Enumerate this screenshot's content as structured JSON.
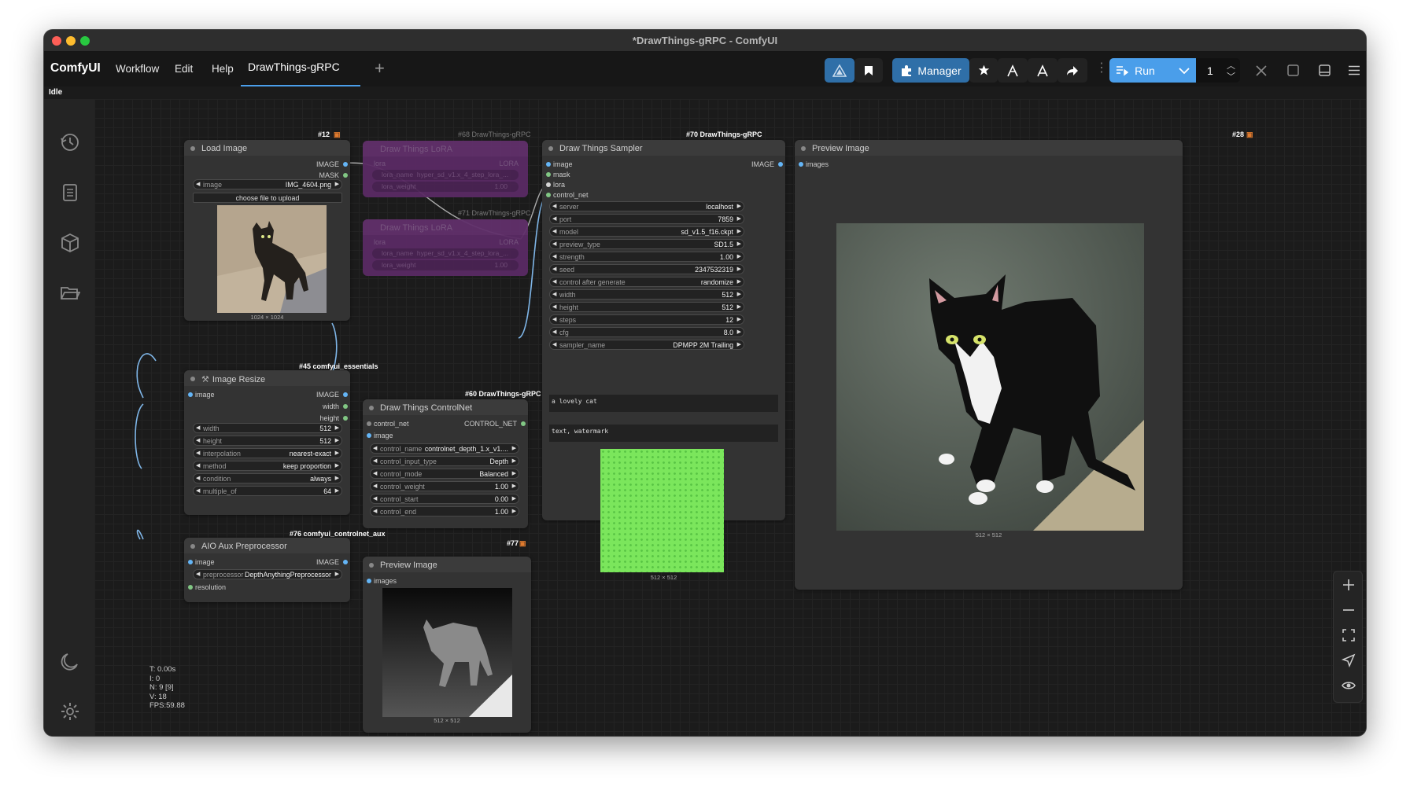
{
  "window": {
    "title": "*DrawThings-gRPC - ComfyUI"
  },
  "menubar": {
    "logo": "ComfyUI",
    "items": [
      "Workflow",
      "Edit",
      "Help"
    ],
    "tab": "DrawThings-gRPC",
    "add_tab": "+",
    "manager": "Manager",
    "run": "Run",
    "queue_count": "1"
  },
  "status": "Idle",
  "nodes": {
    "load_image": {
      "title": "Load Image",
      "tag": "#12",
      "outputs": [
        "IMAGE",
        "MASK"
      ],
      "widget": {
        "label": "image",
        "value": "IMG_4604.png"
      },
      "upload": "choose file to upload",
      "dims": "1024 × 1024"
    },
    "lora1": {
      "title": "Draw Things LoRA",
      "tag": "#68 DrawThings-gRPC",
      "input": "lora",
      "output": "LORA",
      "w1_label": "lora_name",
      "w1_value": "hyper_sd_v1.x_4_step_lora_...",
      "w2_label": "lora_weight",
      "w2_value": "1.00"
    },
    "lora2": {
      "title": "Draw Things LoRA",
      "tag": "#71 DrawThings-gRPC",
      "input": "lora",
      "output": "LORA",
      "w1_label": "lora_name",
      "w1_value": "hyper_sd_v1.x_4_step_lora_...",
      "w2_label": "lora_weight",
      "w2_value": "1.00"
    },
    "sampler": {
      "title": "Draw Things Sampler",
      "tag": "#70 DrawThings-gRPC",
      "inputs": [
        "image",
        "mask",
        "lora",
        "control_net"
      ],
      "output": "IMAGE",
      "widgets": [
        [
          "server",
          "localhost"
        ],
        [
          "port",
          "7859"
        ],
        [
          "model",
          "sd_v1.5_f16.ckpt"
        ],
        [
          "preview_type",
          "SD1.5"
        ],
        [
          "strength",
          "1.00"
        ],
        [
          "seed",
          "2347532319"
        ],
        [
          "control after generate",
          "randomize"
        ],
        [
          "width",
          "512"
        ],
        [
          "height",
          "512"
        ],
        [
          "steps",
          "12"
        ],
        [
          "cfg",
          "8.0"
        ],
        [
          "sampler_name",
          "DPMPP 2M Trailing"
        ]
      ],
      "positive": "a lovely cat",
      "negative": "text, watermark",
      "dims": "512 × 512"
    },
    "preview_main": {
      "title": "Preview Image",
      "tag": "#28",
      "input": "images",
      "dims": "512 × 512"
    },
    "resize": {
      "title": "Image Resize",
      "tag": "#45 comfyui_essentials",
      "input": "image",
      "outputs": [
        "IMAGE",
        "width",
        "height"
      ],
      "widgets": [
        [
          "width",
          "512"
        ],
        [
          "height",
          "512"
        ],
        [
          "interpolation",
          "nearest-exact"
        ],
        [
          "method",
          "keep proportion"
        ],
        [
          "condition",
          "always"
        ],
        [
          "multiple_of",
          "64"
        ]
      ]
    },
    "aio": {
      "title": "AIO Aux Preprocessor",
      "tag": "#76 comfyui_controlnet_aux",
      "input": "image",
      "output": "IMAGE",
      "widget": [
        "preprocessor",
        "DepthAnythingPreprocessor"
      ],
      "resolution": "resolution"
    },
    "controlnet": {
      "title": "Draw Things ControlNet",
      "tag": "#60 DrawThings-gRPC",
      "inputs": [
        "control_net",
        "image"
      ],
      "output": "CONTROL_NET",
      "widgets": [
        [
          "control_name",
          "controlnet_depth_1.x_v1...."
        ],
        [
          "control_input_type",
          "Depth"
        ],
        [
          "control_mode",
          "Balanced"
        ],
        [
          "control_weight",
          "1.00"
        ],
        [
          "control_start",
          "0.00"
        ],
        [
          "control_end",
          "1.00"
        ]
      ]
    },
    "preview_depth": {
      "title": "Preview Image",
      "tag": "#77",
      "input": "images",
      "dims": "512 × 512"
    }
  },
  "stats": [
    "T: 0.00s",
    "I: 0",
    "N: 9 [9]",
    "V: 18",
    "FPS:59.88"
  ],
  "colors": {
    "accent": "#4a9eea",
    "manager": "#2f6fa8",
    "lora": "#5a2a64",
    "link": "#7fb6e8"
  }
}
